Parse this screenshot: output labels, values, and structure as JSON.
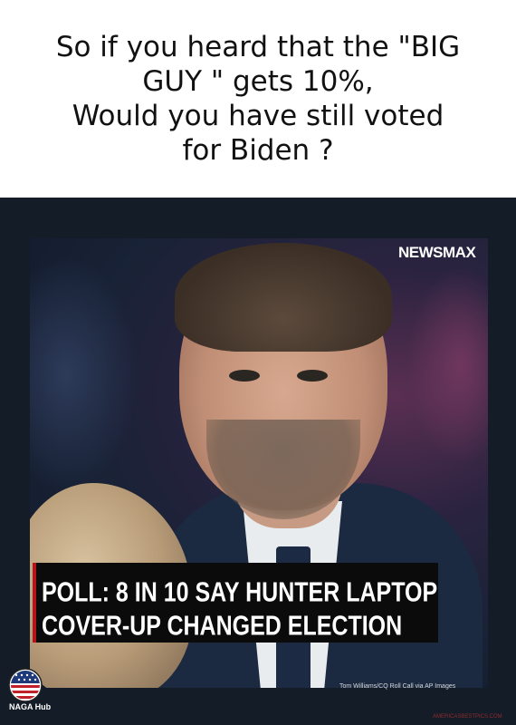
{
  "caption": {
    "text": "So if you heard that the \"BIG GUY \" gets 10%,\nWould you have still voted\nfor Biden ?"
  },
  "news_graphic": {
    "network_logo": "NEWSMAX",
    "headline": "POLL: 8 IN 10 SAY HUNTER LAPTOP\nCOVER-UP CHANGED ELECTION",
    "photo_credit": "Tom Williams/CQ Roll Call via AP Images",
    "watermark": "AMERICASBESTPICS.COM",
    "colors": {
      "headline_bar": "#0b0b0c",
      "accent": "#b5151a"
    }
  },
  "logo": {
    "icon": "american-flag-badge-icon",
    "name": "NAGA Hub"
  }
}
